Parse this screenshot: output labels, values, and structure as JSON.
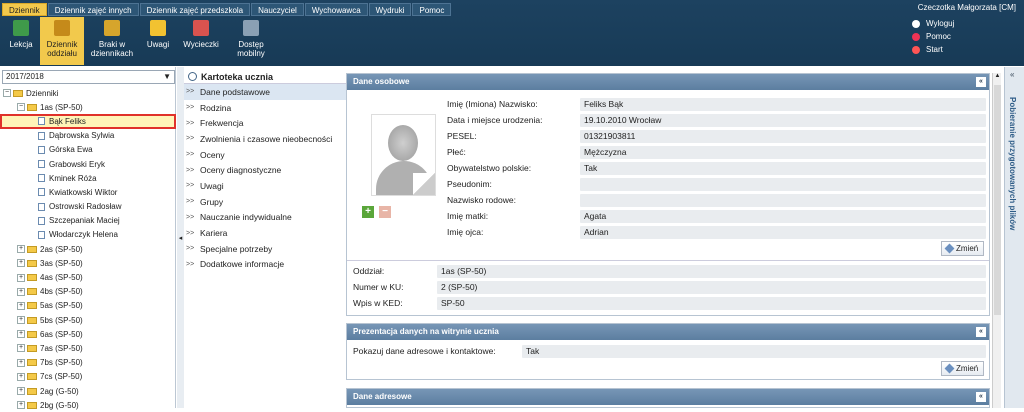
{
  "top_tabs": [
    "Dziennik",
    "Dziennik zajęć innych",
    "Dziennik zajęć przedszkola",
    "Nauczyciel",
    "Wychowawca",
    "Wydruki",
    "Pomoc"
  ],
  "user_name": "Czeczotka Małgorzata [CM]",
  "toolbar": {
    "lekcja": "Lekcja",
    "dziennik_oddzialu_1": "Dziennik",
    "dziennik_oddzialu_2": "oddziału",
    "braki_1": "Braki w",
    "braki_2": "dziennikach",
    "uwagi": "Uwagi",
    "wycieczki": "Wycieczki",
    "dostep_1": "Dostęp",
    "dostep_2": "mobilny"
  },
  "right_menu": {
    "logout": "Wyloguj",
    "help": "Pomoc",
    "start": "Start"
  },
  "year": "2017/2018",
  "tree": {
    "root": "Dzienniki",
    "class_open": "1as (SP-50)",
    "students": [
      "Bąk Feliks",
      "Dąbrowska Sylwia",
      "Górska Ewa",
      "Grabowski Eryk",
      "Kminek Róża",
      "Kwiatkowski Wiktor",
      "Ostrowski Radosław",
      "Szczepaniak Maciej",
      "Włodarczyk Helena"
    ],
    "classes": [
      "2as (SP-50)",
      "3as (SP-50)",
      "4as (SP-50)",
      "4bs (SP-50)",
      "5as (SP-50)",
      "5bs (SP-50)",
      "6as (SP-50)",
      "7as (SP-50)",
      "7bs (SP-50)",
      "7cs (SP-50)",
      "2ag (G-50)",
      "2bg (G-50)"
    ]
  },
  "kartoteka": {
    "title": "Kartoteka ucznia",
    "items": [
      "Dane podstawowe",
      "Rodzina",
      "Frekwencja",
      "Zwolnienia i czasowe nieobecności",
      "Oceny",
      "Oceny diagnostyczne",
      "Uwagi",
      "Grupy",
      "Nauczanie indywidualne",
      "Kariera",
      "Specjalne potrzeby",
      "Dodatkowe informacje"
    ]
  },
  "dane_osobowe": {
    "title": "Dane osobowe",
    "fields": [
      {
        "label": "Imię (Imiona) Nazwisko:",
        "value": "Feliks Bąk"
      },
      {
        "label": "Data i miejsce urodzenia:",
        "value": "19.10.2010 Wrocław"
      },
      {
        "label": "PESEL:",
        "value": "01321903811"
      },
      {
        "label": "Płeć:",
        "value": "Mężczyzna"
      },
      {
        "label": "Obywatelstwo polskie:",
        "value": "Tak"
      },
      {
        "label": "Pseudonim:",
        "value": ""
      },
      {
        "label": "Nazwisko rodowe:",
        "value": ""
      },
      {
        "label": "Imię matki:",
        "value": "Agata"
      },
      {
        "label": "Imię ojca:",
        "value": "Adrian"
      }
    ],
    "edit_label": "Zmień",
    "class_fields": [
      {
        "label": "Oddział:",
        "value": "1as (SP-50)"
      },
      {
        "label": "Numer w KU:",
        "value": "2 (SP-50)"
      },
      {
        "label": "Wpis w KED:",
        "value": "SP-50"
      }
    ]
  },
  "prezentacja": {
    "title": "Prezentacja danych na witrynie ucznia",
    "label": "Pokazuj dane adresowe i kontaktowe:",
    "value": "Tak",
    "edit_label": "Zmień"
  },
  "dane_adresowe": {
    "title": "Dane adresowe"
  },
  "side_strip_label": "Pobieranie przygotowanych plików"
}
